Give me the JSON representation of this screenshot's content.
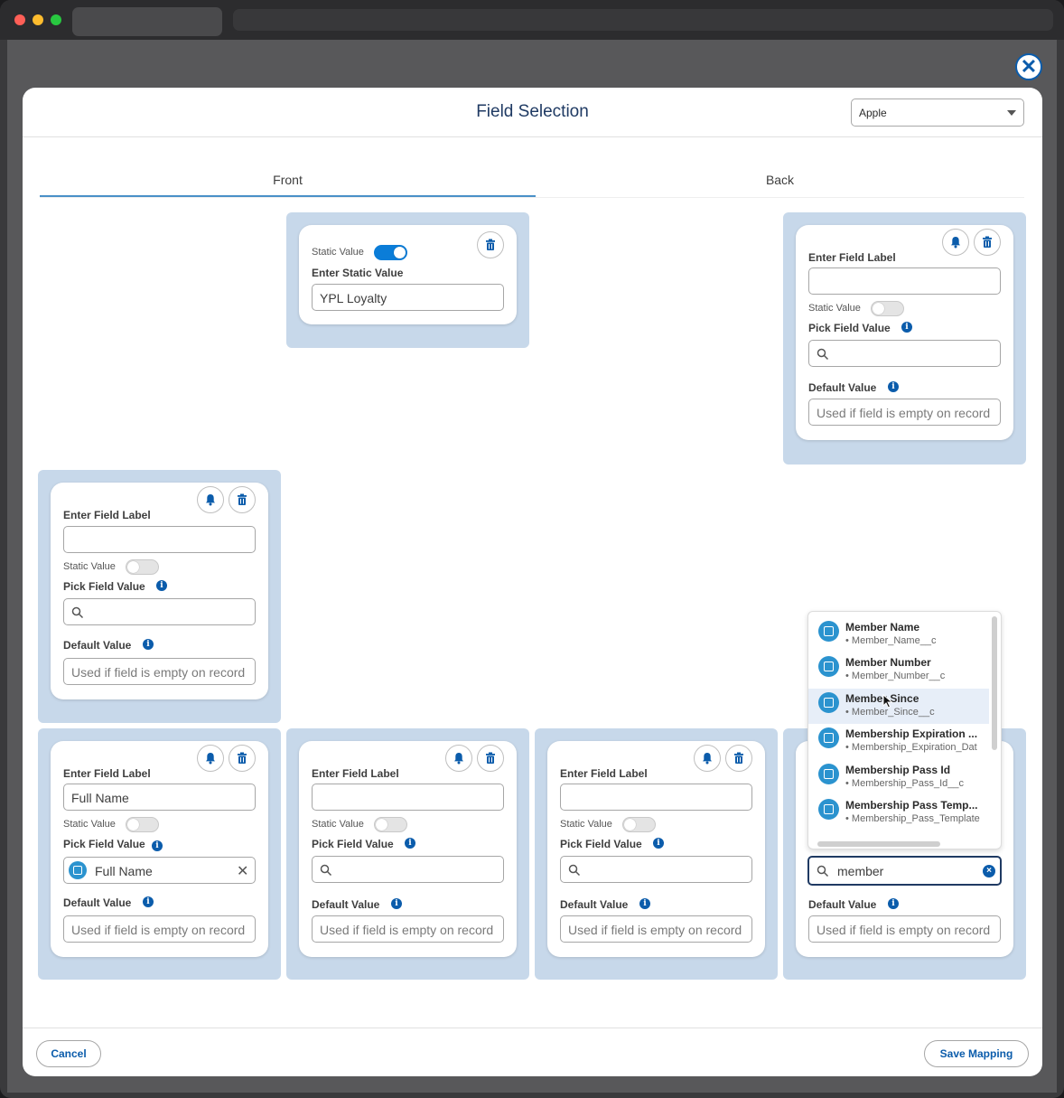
{
  "modal": {
    "title": "Field Selection",
    "platform_select": "Apple"
  },
  "tabs": {
    "front": "Front",
    "back": "Back"
  },
  "labels": {
    "enter_field_label": "Enter Field Label",
    "static_value": "Static Value",
    "enter_static_value": "Enter Static Value",
    "pick_field_value": "Pick Field Value",
    "default_value": "Default Value",
    "default_placeholder": "Used if field is empty on record"
  },
  "cards": {
    "front_static": {
      "static_value_on": true,
      "static_text": "YPL Loyalty"
    },
    "front_row2": {
      "field_label": "",
      "pick_value": ""
    },
    "front_row3_a": {
      "field_label": "Full Name",
      "pick_value": "Full Name"
    },
    "front_row3_b": {
      "field_label": "",
      "pick_value": ""
    },
    "back_row1": {
      "field_label": "",
      "pick_value": ""
    },
    "back_row3_a": {
      "field_label": "",
      "pick_value": ""
    },
    "back_row3_b": {
      "search_text": "member"
    }
  },
  "dropdown": {
    "items": [
      {
        "name": "Member Name",
        "api": "• Member_Name__c",
        "highlighted": false
      },
      {
        "name": "Member Number",
        "api": "• Member_Number__c",
        "highlighted": false
      },
      {
        "name": "Member Since",
        "api": "• Member_Since__c",
        "highlighted": true
      },
      {
        "name": "Membership Expiration ...",
        "api": "• Membership_Expiration_Dat",
        "highlighted": false
      },
      {
        "name": "Membership Pass Id",
        "api": "• Membership_Pass_Id__c",
        "highlighted": false
      },
      {
        "name": "Membership Pass Temp...",
        "api": "• Membership_Pass_Template",
        "highlighted": false
      }
    ]
  },
  "footer": {
    "cancel": "Cancel",
    "save": "Save Mapping"
  },
  "colors": {
    "accent": "#0b5cab",
    "slot_bg": "#c7d8ea",
    "toggle_on": "#0b7dd8"
  },
  "icons": [
    "close-icon",
    "bell-icon",
    "trash-icon",
    "search-icon",
    "info-icon",
    "chevron-down-icon",
    "field-icon",
    "clear-icon"
  ]
}
